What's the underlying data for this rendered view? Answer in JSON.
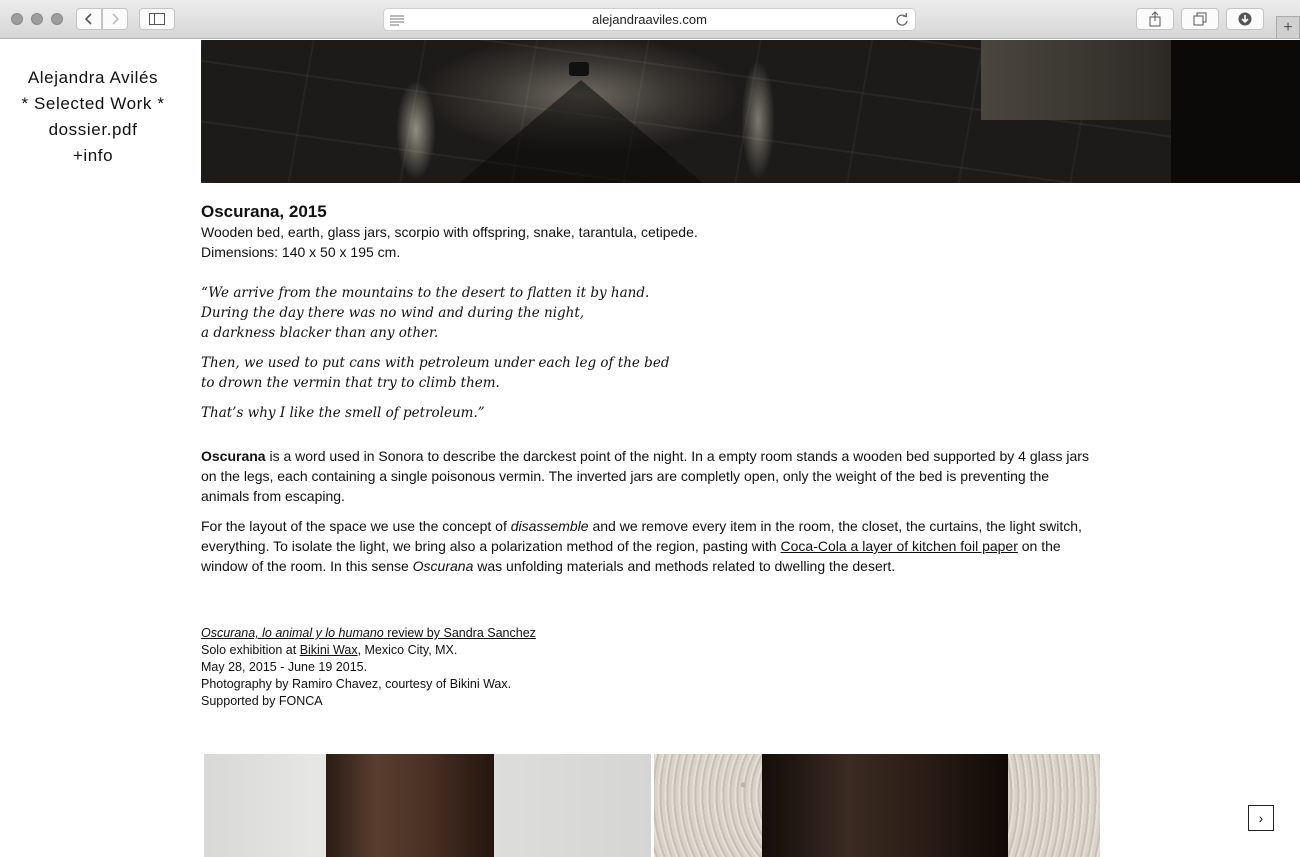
{
  "browser": {
    "url": "alejandraaviles.com"
  },
  "sidebar": {
    "items": [
      {
        "label": "Alejandra Avilés"
      },
      {
        "label": "* Selected Work *"
      },
      {
        "label": "dossier.pdf"
      },
      {
        "label": "+info"
      }
    ]
  },
  "work": {
    "title": "Oscurana, 2015",
    "materials": "Wooden bed, earth, glass jars, scorpio with offspring, snake, tarantula, cetipede.",
    "dimensions": "Dimensions: 140 x 50 x 195 cm.",
    "poem": {
      "stanza1": [
        "“We arrive from the mountains to the desert to flatten it by hand.",
        "During the day there was no wind and during the night,",
        "a darkness blacker than any other."
      ],
      "stanza2": [
        "Then, we used to put cans with petroleum under each leg of the bed",
        "to drown the vermin that try to climb them."
      ],
      "stanza3": [
        "That’s why I like the smell of petroleum.”"
      ]
    },
    "paragraph1": {
      "bold": "Oscurana",
      "text": " is a word used in Sonora to describe the darckest point of the night. In a empty room stands a wooden bed supported by 4 glass jars on the legs, each containing a single poisonous vermin. The inverted jars are completly open, only the weight of the bed is preventing the animals from escaping."
    },
    "paragraph2": {
      "part1": "For the layout of the space we use the concept of ",
      "italic1": "disassemble",
      "part2": " and we remove every item in the room, the closet, the curtains, the light switch, everything. To isolate the light, we bring also a polarization method of the region, pasting with ",
      "link": "Coca-Cola a layer of kitchen foil paper",
      "part3": " on the window of the room. In this sense ",
      "italic2": "Oscurana",
      "part4": " was unfolding materials and methods related to dwelling the desert."
    },
    "credits": {
      "review_italic": "Oscurana, lo animal y lo humano",
      "review_rest": " review by Sandra Sanchez",
      "exhibition_prefix": "Solo exhibition at ",
      "exhibition_link": "Bikini Wax",
      "exhibition_suffix": ", Mexico City, MX.",
      "dates": "May 28, 2015 - June 19 2015.",
      "photography": "Photography by Ramiro Chavez, courtesy of Bikini Wax.",
      "support": "Supported by FONCA"
    }
  },
  "nav": {
    "next_label": "›"
  }
}
